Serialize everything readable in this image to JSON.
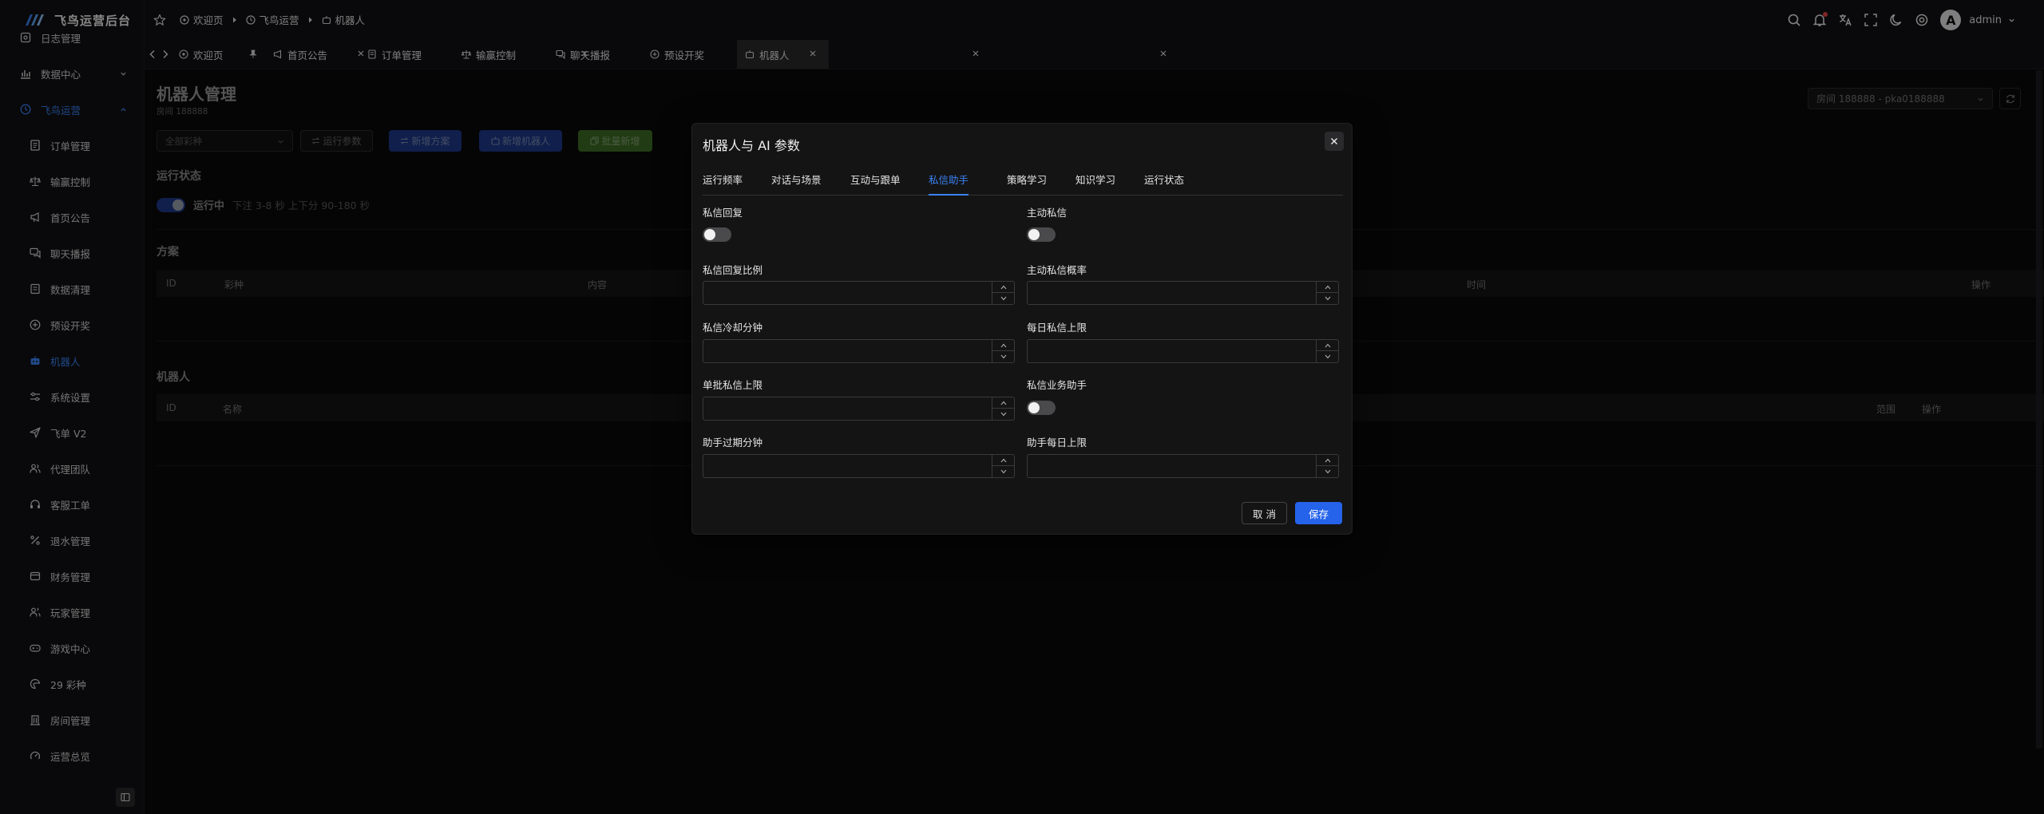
{
  "app": {
    "title": "飞鸟运营后台"
  },
  "sidebar": {
    "items": [
      {
        "label": "日志管理",
        "icon": "log-icon"
      },
      {
        "label": "数据中心",
        "icon": "chart-icon"
      },
      {
        "label": "飞鸟运营",
        "icon": "clock-icon",
        "expanded": true
      },
      {
        "label": "订单管理",
        "icon": "document-icon"
      },
      {
        "label": "输赢控制",
        "icon": "scale-icon"
      },
      {
        "label": "首页公告",
        "icon": "megaphone-icon"
      },
      {
        "label": "聊天播报",
        "icon": "chat-icon"
      },
      {
        "label": "数据清理",
        "icon": "trash-icon"
      },
      {
        "label": "预设开奖",
        "icon": "plus-circle-icon"
      },
      {
        "label": "机器人",
        "icon": "robot-icon",
        "active": true
      },
      {
        "label": "系统设置",
        "icon": "sliders-icon"
      },
      {
        "label": "飞单 V2",
        "icon": "send-icon"
      },
      {
        "label": "代理团队",
        "icon": "users-icon"
      },
      {
        "label": "客服工单",
        "icon": "headset-icon"
      },
      {
        "label": "退水管理",
        "icon": "percent-icon"
      },
      {
        "label": "财务管理",
        "icon": "wallet-icon"
      },
      {
        "label": "玩家管理",
        "icon": "user-group-icon"
      },
      {
        "label": "游戏中心",
        "icon": "gamepad-icon"
      },
      {
        "label": "29 彩种",
        "icon": "lottery-icon"
      },
      {
        "label": "房间管理",
        "icon": "building-icon"
      },
      {
        "label": "运营总览",
        "icon": "gauge-icon"
      }
    ]
  },
  "breadcrumb": [
    "欢迎页",
    "飞鸟运营",
    "机器人"
  ],
  "header": {
    "username": "admin",
    "avatar_letter": "A"
  },
  "tabs": [
    {
      "label": "欢迎页",
      "closable": false
    },
    {
      "label": "首页公告",
      "closable": true,
      "pinned": true
    },
    {
      "label": "订单管理",
      "closable": true
    },
    {
      "label": "输赢控制",
      "closable": true
    },
    {
      "label": "聊天播报",
      "closable": true
    },
    {
      "label": "预设开奖",
      "closable": true
    },
    {
      "label": "机器人",
      "closable": true,
      "active": true
    }
  ],
  "page": {
    "title": "机器人管理",
    "subtitle": "房间 188888",
    "room_select": "房间 188888 - pka0188888",
    "filter_placeholder": "全部彩种",
    "buttons": {
      "run_params": "运行参数",
      "add_plan": "新增方案",
      "add_robot": "新增机器人",
      "batch_add": "批量新增"
    },
    "run_status": {
      "title": "运行状态",
      "state": "运行中",
      "detail": "下注 3-8 秒  上下分 90-180 秒"
    },
    "plans": {
      "title": "方案",
      "columns": [
        "ID",
        "彩种",
        "内容",
        "时间",
        "操作"
      ]
    },
    "robots": {
      "title": "机器人",
      "columns": [
        "ID",
        "名称",
        "范围",
        "操作"
      ]
    }
  },
  "modal": {
    "title": "机器人与 AI 参数",
    "tabs": [
      "运行频率",
      "对话与场景",
      "互动与跟单",
      "私信助手",
      "策略学习",
      "知识学习",
      "运行状态"
    ],
    "active_tab": "私信助手",
    "fields": [
      {
        "label": "私信回复",
        "type": "toggle",
        "on": false
      },
      {
        "label": "主动私信",
        "type": "toggle",
        "on": false
      },
      {
        "label": "私信回复比例",
        "type": "number",
        "value": ""
      },
      {
        "label": "主动私信概率",
        "type": "number",
        "value": ""
      },
      {
        "label": "私信冷却分钟",
        "type": "number",
        "value": ""
      },
      {
        "label": "每日私信上限",
        "type": "number",
        "value": ""
      },
      {
        "label": "单批私信上限",
        "type": "number",
        "value": ""
      },
      {
        "label": "私信业务助手",
        "type": "toggle",
        "on": false
      },
      {
        "label": "助手过期分钟",
        "type": "number",
        "value": ""
      },
      {
        "label": "助手每日上限",
        "type": "number",
        "value": ""
      }
    ],
    "cancel": "取 消",
    "save": "保存"
  },
  "colors": {
    "accent": "#2563eb",
    "active_text": "#3b82f6",
    "batch_green": "#4d8a2f",
    "toggle_on": "#1e3a8a"
  }
}
